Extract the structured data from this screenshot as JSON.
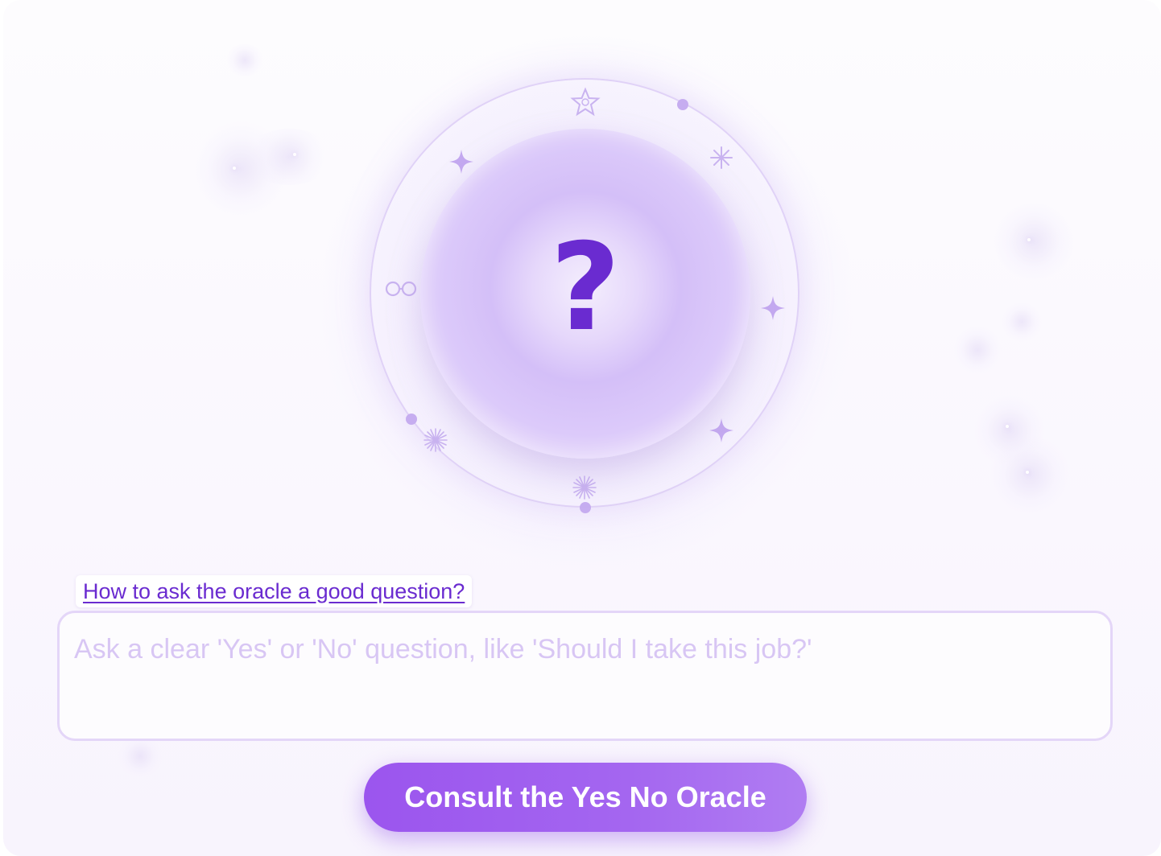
{
  "oracle": {
    "symbol": "?",
    "accent_color": "#6a2bd0",
    "ring_icons": [
      "star-outline-icon",
      "dot-icon",
      "asterisk-icon",
      "sparkle-icon",
      "infinity-icon",
      "sparkle-icon",
      "sparkle-icon",
      "dot-icon",
      "sunburst-icon",
      "sunburst-icon",
      "dot-icon"
    ]
  },
  "help": {
    "link_text": "How to ask the oracle a good question?"
  },
  "question": {
    "value": "",
    "placeholder": "Ask a clear 'Yes' or 'No' question, like 'Should I take this job?'"
  },
  "actions": {
    "consult_label": "Consult the Yes No Oracle",
    "button_color": "#9b55ee"
  }
}
